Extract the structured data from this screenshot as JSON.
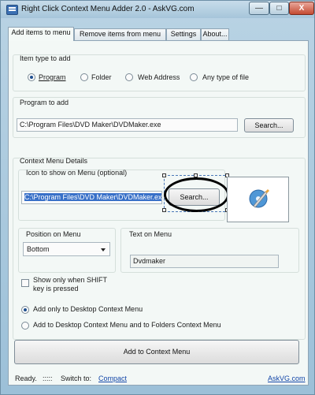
{
  "window": {
    "title": "Right Click Context Menu Adder 2.0  -  AskVG.com",
    "min_glyph": "—",
    "max_glyph": "□",
    "close_glyph": "X"
  },
  "tabs": [
    {
      "label": "Add items to menu"
    },
    {
      "label": "Remove items from menu"
    },
    {
      "label": "Settings"
    },
    {
      "label": "About..."
    }
  ],
  "item_type": {
    "group_label": "Item type to add",
    "options": [
      {
        "label": "Program",
        "selected": true
      },
      {
        "label": "Folder",
        "selected": false
      },
      {
        "label": "Web Address",
        "selected": false
      },
      {
        "label": "Any type of file",
        "selected": false
      }
    ]
  },
  "program": {
    "group_label": "Program to add",
    "path": "C:\\Program Files\\DVD Maker\\DVDMaker.exe",
    "search_label": "Search..."
  },
  "context_menu": {
    "group_label": "Context Menu Details",
    "icon_label": "Icon to show on Menu (optional)",
    "icon_path": "C:\\Program Files\\DVD Maker\\DVDMaker.exe",
    "icon_search_label": "Search...",
    "position_label": "Position on Menu",
    "position_value": "Bottom",
    "text_label": "Text on Menu",
    "text_value": "Dvdmaker",
    "shift_label_line1": "Show only when SHIFT",
    "shift_label_line2": "key is pressed",
    "shift_checked": false,
    "target_options": [
      {
        "label": "Add only to Desktop Context Menu",
        "selected": true
      },
      {
        "label": "Add to Desktop Context Menu and to Folders Context Menu",
        "selected": false
      }
    ],
    "add_button_label": "Add to Context Menu"
  },
  "status": {
    "ready": "Ready.",
    "dots": ":::::",
    "switch_to": "Switch to:",
    "compact": "Compact",
    "site": "AskVG.com"
  },
  "colors": {
    "accent_selection": "#3870c8",
    "link": "#1246a8",
    "panel": "#f3f8f6",
    "frame": "#9cc0d8"
  }
}
